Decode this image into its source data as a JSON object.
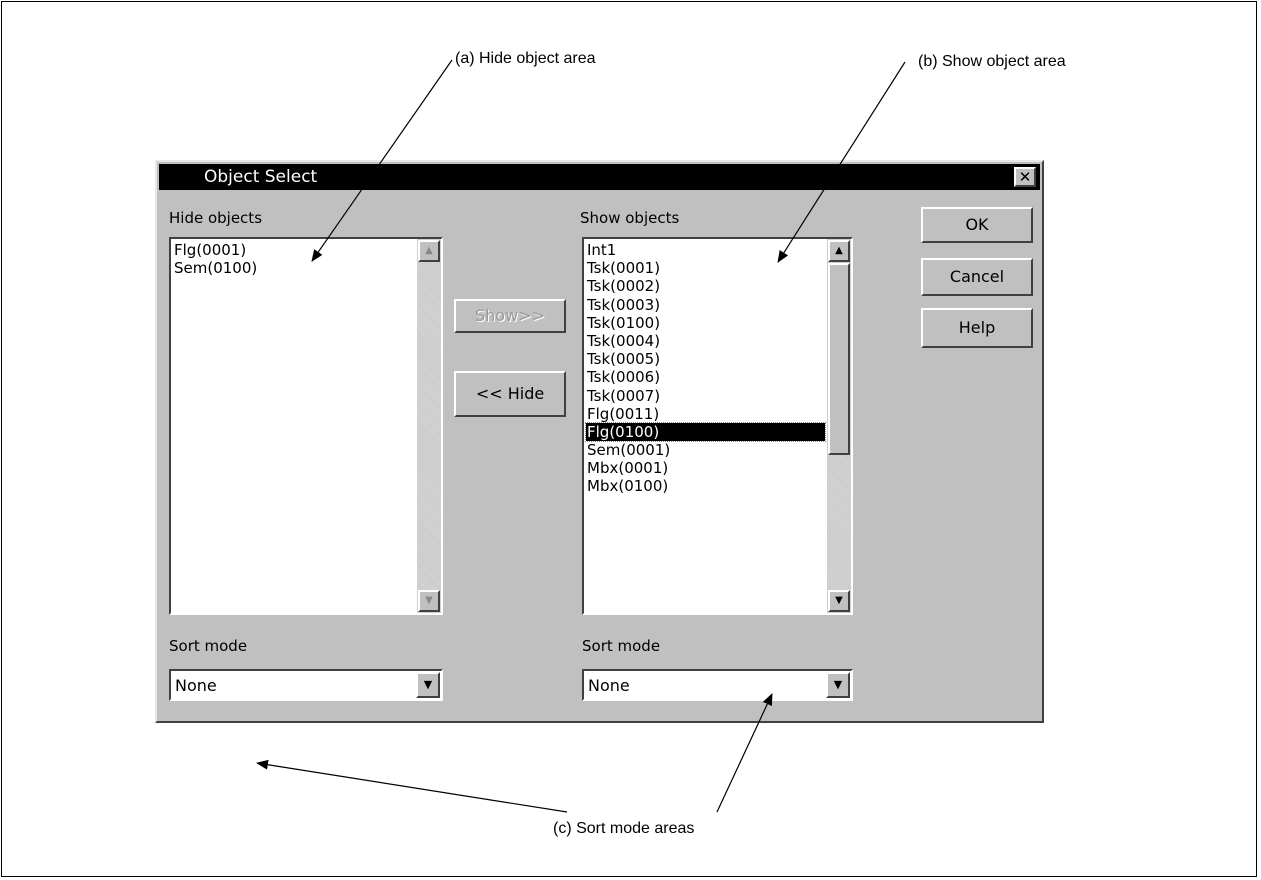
{
  "callouts": {
    "hide_area": "(a) Hide object area",
    "show_area": "(b) Show object area",
    "sort_areas": "(c) Sort mode areas"
  },
  "dialog": {
    "title": "Object Select",
    "close_glyph": "✕",
    "hide_objects_label": "Hide objects",
    "show_objects_label": "Show objects",
    "hide_items": [
      "Flg(0001)",
      "Sem(0100)"
    ],
    "show_items": [
      "Int1",
      "Tsk(0001)",
      "Tsk(0002)",
      "Tsk(0003)",
      "Tsk(0100)",
      "Tsk(0004)",
      "Tsk(0005)",
      "Tsk(0006)",
      "Tsk(0007)",
      "Flg(0011)",
      "Flg(0100)",
      "Sem(0001)",
      "Mbx(0001)",
      "Mbx(0100)"
    ],
    "show_selected": "Flg(0100)",
    "show_button": "Show>>",
    "hide_button": "<< Hide",
    "ok_button": "OK",
    "cancel_button": "Cancel",
    "help_button": "Help",
    "left_sort_label": "Sort mode",
    "right_sort_label": "Sort mode",
    "left_sort_value": "None",
    "right_sort_value": "None",
    "scroll_up_glyph": "▲",
    "scroll_down_glyph": "▼",
    "dropdown_glyph": "▼"
  }
}
